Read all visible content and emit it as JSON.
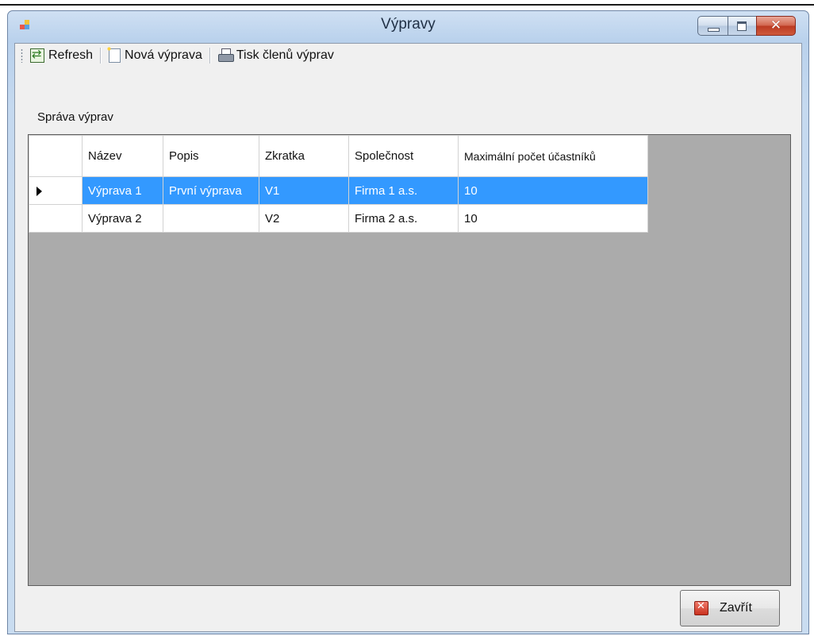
{
  "window": {
    "title": "Výpravy"
  },
  "toolbar": {
    "refresh_label": "Refresh",
    "new_label": "Nová výprava",
    "print_label": "Tisk členů výprav"
  },
  "section": {
    "label": "Správa výprav"
  },
  "grid": {
    "columns": [
      "Název",
      "Popis",
      "Zkratka",
      "Společnost",
      "Maximální počet účastníků"
    ],
    "rows": [
      {
        "selected": true,
        "cells": [
          "Výprava 1",
          "První výprava",
          "V1",
          "Firma 1 a.s.",
          "10"
        ]
      },
      {
        "selected": false,
        "cells": [
          "Výprava 2",
          "",
          "V2",
          "Firma 2 a.s.",
          "10"
        ]
      }
    ],
    "colors": {
      "selection": "#3399ff",
      "background": "#ababab"
    }
  },
  "footer": {
    "close_label": "Zavřít"
  }
}
